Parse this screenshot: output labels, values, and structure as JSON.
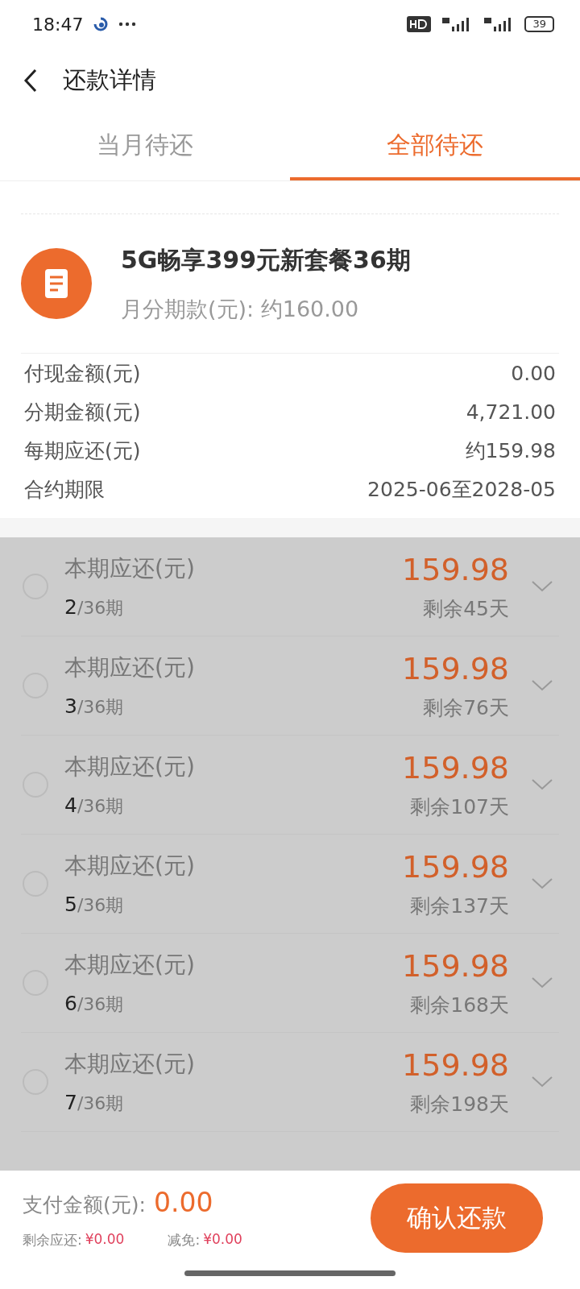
{
  "status_bar": {
    "time": "18:47",
    "battery": "39"
  },
  "header": {
    "title": "还款详情"
  },
  "tabs": [
    {
      "label": "当月待还",
      "selected": false
    },
    {
      "label": "全部待还",
      "selected": true
    }
  ],
  "plan": {
    "title": "5G畅享399元新套餐36期",
    "subtitle": "月分期款(元): 约160.00"
  },
  "details": [
    {
      "label": "付现金额(元)",
      "value": "0.00"
    },
    {
      "label": "分期金额(元)",
      "value": "4,721.00"
    },
    {
      "label": "每期应还(元)",
      "value": "约159.98"
    },
    {
      "label": "合约期限",
      "value": "2025-06至2028-05"
    }
  ],
  "installments": {
    "disabled": true,
    "rows": [
      {
        "title": "本期应还(元)",
        "amount": "159.98",
        "period": "2",
        "total": "/36期",
        "remaining": "剩余45天",
        "selected": false
      },
      {
        "title": "本期应还(元)",
        "amount": "159.98",
        "period": "3",
        "total": "/36期",
        "remaining": "剩余76天",
        "selected": false
      },
      {
        "title": "本期应还(元)",
        "amount": "159.98",
        "period": "4",
        "total": "/36期",
        "remaining": "剩余107天",
        "selected": false
      },
      {
        "title": "本期应还(元)",
        "amount": "159.98",
        "period": "5",
        "total": "/36期",
        "remaining": "剩余137天",
        "selected": false
      },
      {
        "title": "本期应还(元)",
        "amount": "159.98",
        "period": "6",
        "total": "/36期",
        "remaining": "剩余168天",
        "selected": false
      },
      {
        "title": "本期应还(元)",
        "amount": "159.98",
        "period": "7",
        "total": "/36期",
        "remaining": "剩余198天",
        "selected": false
      }
    ]
  },
  "footer": {
    "pay_label": "支付金额(元):",
    "pay_amount": "0.00",
    "remaining_label": "剩余应还:",
    "remaining_value": "¥0.00",
    "discount_label": "减免:",
    "discount_value": "¥0.00",
    "confirm_button": "确认还款"
  }
}
